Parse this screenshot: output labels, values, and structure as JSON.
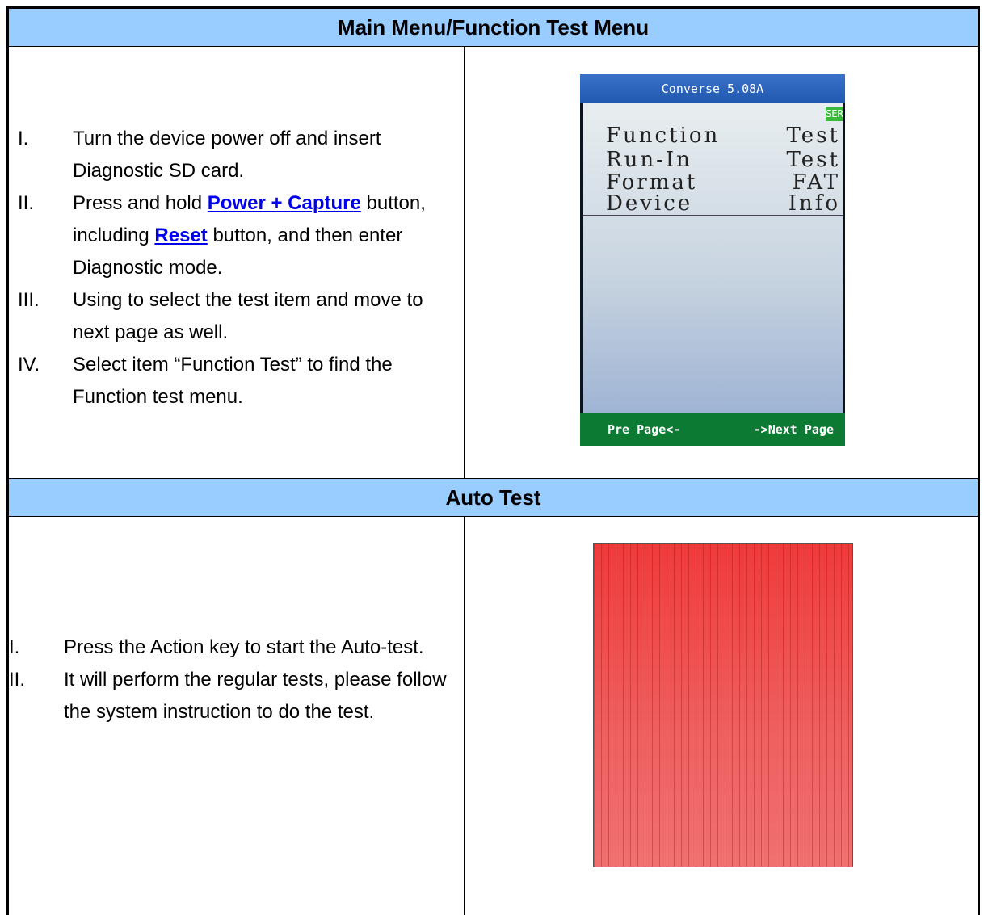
{
  "section1": {
    "header": "Main Menu/Function Test Menu",
    "steps": [
      {
        "num": "I.",
        "parts": [
          "Turn the device power off and insert Diagnostic SD card."
        ]
      },
      {
        "num": "II.",
        "pre": "Press and hold ",
        "hl1": "Power + Capture",
        "mid": " button, including ",
        "hl2": "Reset",
        "post": " button, and then enter Diagnostic mode."
      },
      {
        "num": "III.",
        "text": "Using to select the test item and move to next page as well."
      },
      {
        "num": "IV.",
        "text": "Select item “Function Test” to find the Function test menu."
      }
    ],
    "device": {
      "title": "Converse 5.08A",
      "badge": "SER",
      "items": [
        {
          "left": "Function",
          "right": "Test"
        },
        {
          "left": "Run-In",
          "right": "Test"
        },
        {
          "left": "Format",
          "right": "FAT"
        },
        {
          "left": "Device",
          "right": "Info"
        }
      ],
      "footer_prev": "Pre Page<-",
      "footer_next": "->Next Page"
    }
  },
  "section2": {
    "header": "Auto Test",
    "steps": [
      {
        "num": "I.",
        "text": "Press the Action key to start the Auto-test."
      },
      {
        "num": "II.",
        "text": "It will perform the regular tests, please follow the system instruction to do the test."
      }
    ],
    "image_color": "#f04848"
  }
}
